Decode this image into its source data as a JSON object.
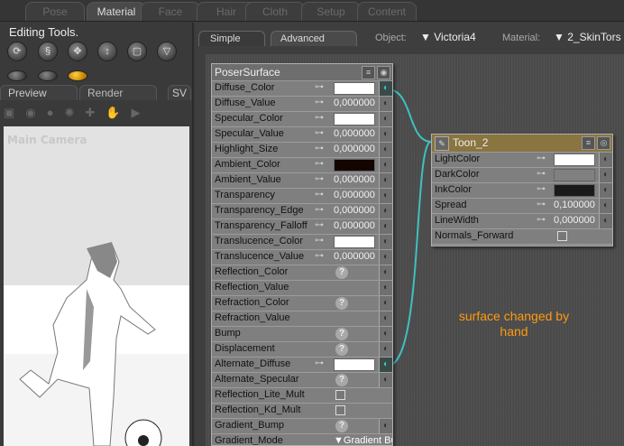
{
  "top_tabs": [
    {
      "label": "Pose"
    },
    {
      "label": "Material",
      "active": true
    },
    {
      "label": "Face"
    },
    {
      "label": "Hair"
    },
    {
      "label": "Cloth"
    },
    {
      "label": "Setup"
    },
    {
      "label": "Content"
    }
  ],
  "editing_tools": {
    "title": "Editing Tools."
  },
  "preview_tabs": [
    "Preview",
    "Render",
    "SV"
  ],
  "viewport": {
    "camera_label": "Main Camera"
  },
  "sub_tabs": [
    "Simple",
    "Advanced"
  ],
  "object": {
    "label": "Object:",
    "value": "Victoria4"
  },
  "material": {
    "label": "Material:",
    "value": "2_SkinTors"
  },
  "poser_surface": {
    "title": "PoserSurface",
    "rows": [
      {
        "label": "Diffuse_Color",
        "type": "color",
        "color": "#ffffff",
        "connected": true
      },
      {
        "label": "Diffuse_Value",
        "type": "value",
        "value": "0,000000"
      },
      {
        "label": "Specular_Color",
        "type": "color",
        "color": "#ffffff"
      },
      {
        "label": "Specular_Value",
        "type": "value",
        "value": "0,000000"
      },
      {
        "label": "Highlight_Size",
        "type": "value",
        "value": "0,000000"
      },
      {
        "label": "Ambient_Color",
        "type": "color",
        "color": "#150500"
      },
      {
        "label": "Ambient_Value",
        "type": "value",
        "value": "0,000000"
      },
      {
        "label": "Transparency",
        "type": "value",
        "value": "0,000000"
      },
      {
        "label": "Transparency_Edge",
        "type": "value",
        "value": "0,000000"
      },
      {
        "label": "Transparency_Falloff",
        "type": "value",
        "value": "0,000000"
      },
      {
        "label": "Translucence_Color",
        "type": "color",
        "color": "#ffffff"
      },
      {
        "label": "Translucence_Value",
        "type": "value",
        "value": "0,000000"
      },
      {
        "label": "Reflection_Color",
        "type": "question"
      },
      {
        "label": "Reflection_Value",
        "type": "none"
      },
      {
        "label": "Refraction_Color",
        "type": "question"
      },
      {
        "label": "Refraction_Value",
        "type": "none"
      },
      {
        "label": "Bump",
        "type": "question"
      },
      {
        "label": "Displacement",
        "type": "question"
      },
      {
        "label": "Alternate_Diffuse",
        "type": "color",
        "color": "#ffffff",
        "connected": true
      },
      {
        "label": "Alternate_Specular",
        "type": "question"
      },
      {
        "label": "Reflection_Lite_Mult",
        "type": "check"
      },
      {
        "label": "Reflection_Kd_Mult",
        "type": "check"
      },
      {
        "label": "Gradient_Bump",
        "type": "question"
      },
      {
        "label": "Gradient_Mode",
        "type": "dropdown",
        "value": "Gradient Bu"
      }
    ]
  },
  "toon_node": {
    "title": "Toon_2",
    "rows": [
      {
        "label": "LightColor",
        "type": "color",
        "color": "#ffffff"
      },
      {
        "label": "DarkColor",
        "type": "color",
        "color": "#808080"
      },
      {
        "label": "InkColor",
        "type": "color",
        "color": "#1a1a1a"
      },
      {
        "label": "Spread",
        "type": "value",
        "value": "0,100000"
      },
      {
        "label": "LineWidth",
        "type": "value",
        "value": "0,000000"
      },
      {
        "label": "Normals_Forward",
        "type": "check"
      }
    ]
  },
  "annotation": "surface changed by hand",
  "colors": {
    "cable": "#3fc0c0",
    "annotation": "#ff9a10",
    "toon_header": "#8a7440"
  }
}
